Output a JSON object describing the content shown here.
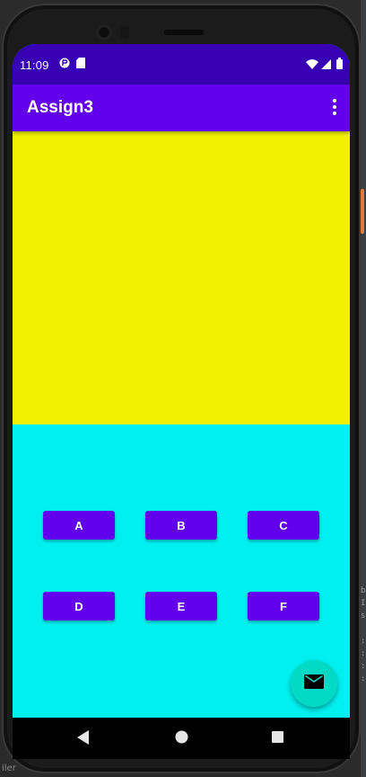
{
  "status_bar": {
    "time": "11:09",
    "left_icons": [
      "cast-icon",
      "sd-card-icon"
    ],
    "right_icons": [
      "wifi-icon",
      "signal-icon",
      "battery-icon"
    ]
  },
  "app_bar": {
    "title": "Assign3",
    "overflow_icon": "more-vert-icon"
  },
  "panels": {
    "top_color": "#f2f200",
    "bottom_color": "#00f0f0"
  },
  "buttons": {
    "row1": [
      "A",
      "B",
      "C"
    ],
    "row2": [
      "D",
      "E",
      "F"
    ]
  },
  "fab": {
    "icon": "email-icon",
    "color": "#03dac5"
  },
  "nav_bar": {
    "icons": [
      "back-icon",
      "home-icon",
      "recents-icon"
    ]
  },
  "ide": {
    "bottom_text": "iler"
  },
  "colors": {
    "primary": "#6200ee",
    "primary_dark": "#3700b3",
    "accent": "#03dac5"
  }
}
